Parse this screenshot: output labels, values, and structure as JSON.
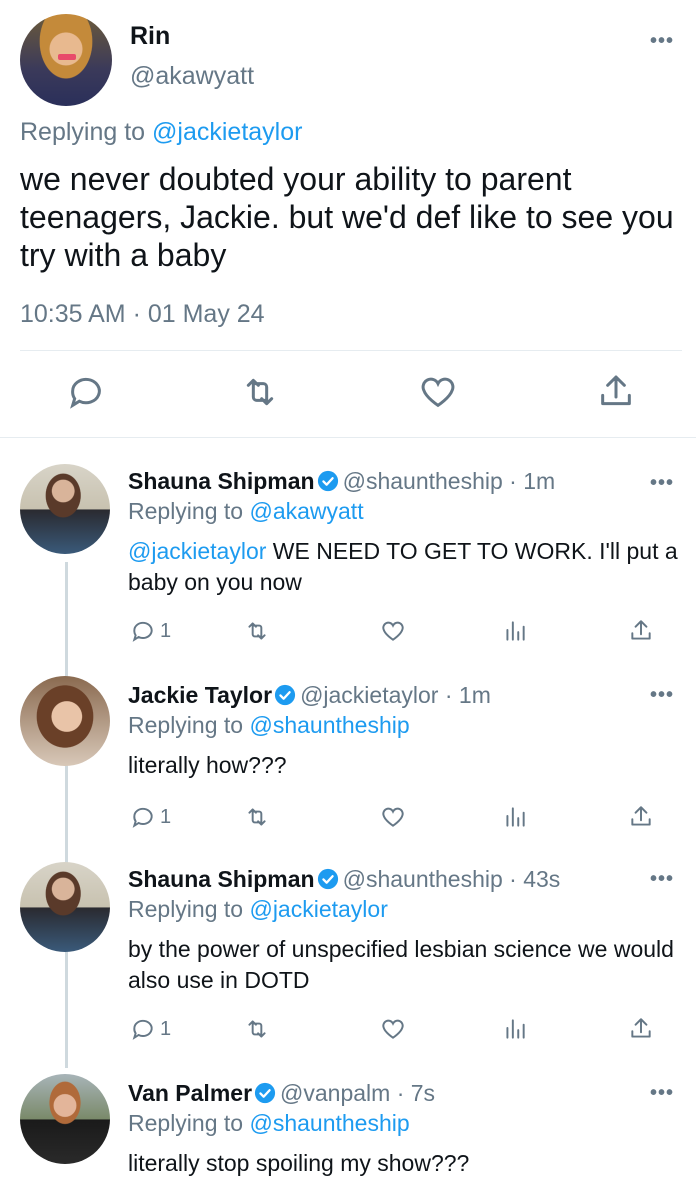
{
  "main_tweet": {
    "name": "Rin",
    "handle": "@akawyatt",
    "replying_prefix": "Replying to ",
    "replying_to": "@jackietaylor",
    "text": "we never doubted your ability to parent teenagers, Jackie. but we'd def like to see you try with a baby",
    "timestamp": "10:35 AM · 01 May 24",
    "more": "•••"
  },
  "replies": [
    {
      "name": "Shauna Shipman",
      "handle": "@shauntheship",
      "time": "· 1m",
      "replying_prefix": "Replying to ",
      "replying_to": "@akawyatt",
      "mention": "@jackietaylor",
      "text": " WE NEED TO GET TO WORK. I'll put a baby on you now",
      "reply_count": "1",
      "more": "•••"
    },
    {
      "name": "Jackie Taylor",
      "handle": "@jackietaylor",
      "time": "· 1m",
      "replying_prefix": "Replying to ",
      "replying_to": "@shauntheship",
      "text": "literally how???",
      "reply_count": "1",
      "more": "•••"
    },
    {
      "name": "Shauna Shipman",
      "handle": "@shauntheship",
      "time": "· 43s",
      "replying_prefix": "Replying to ",
      "replying_to": "@jackietaylor",
      "text": "by the power of unspecified lesbian science we would also use in DOTD",
      "reply_count": "1",
      "more": "•••"
    },
    {
      "name": "Van Palmer",
      "handle": "@vanpalm",
      "time": "· 7s",
      "replying_prefix": "Replying to ",
      "replying_to": "@shauntheship",
      "text": "literally stop spoiling my show???",
      "more": "•••"
    }
  ],
  "icons": {
    "reply": "reply-icon",
    "retweet": "retweet-icon",
    "like": "heart-icon",
    "analytics": "analytics-icon",
    "share": "share-icon",
    "verified": "verified-badge-icon"
  },
  "colors": {
    "link": "#1d9bf0",
    "secondary": "#657786",
    "verified": "#1d9bf0"
  }
}
